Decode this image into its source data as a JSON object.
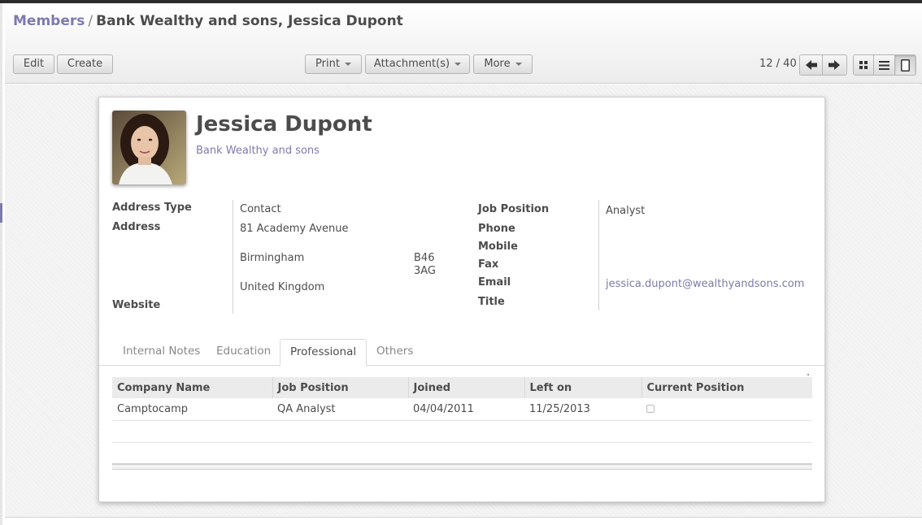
{
  "breadcrumb": {
    "parent": "Members",
    "separator": "/",
    "current": "Bank Wealthy and sons, Jessica Dupont"
  },
  "toolbar": {
    "edit": "Edit",
    "create": "Create",
    "print": "Print",
    "attachments": "Attachment(s)",
    "more": "More",
    "pager": "12 / 40"
  },
  "contact": {
    "name": "Jessica Dupont",
    "company": "Bank Wealthy and sons"
  },
  "left_fields": {
    "address_type_label": "Address Type",
    "address_type_value": "Contact",
    "address_label": "Address",
    "street": "81 Academy Avenue",
    "city": "Birmingham",
    "zip_line1": "B46",
    "zip_line2": "3AG",
    "country": "United Kingdom",
    "website_label": "Website"
  },
  "right_fields": {
    "job_position_label": "Job Position",
    "job_position_value": "Analyst",
    "phone_label": "Phone",
    "mobile_label": "Mobile",
    "fax_label": "Fax",
    "email_label": "Email",
    "email_value": "jessica.dupont@wealthyandsons.com",
    "title_label": "Title"
  },
  "tabs": [
    "Internal Notes",
    "Education",
    "Professional",
    "Others"
  ],
  "active_tab": "Professional",
  "table": {
    "headers": [
      "Company Name",
      "Job Position",
      "Joined",
      "Left on",
      "Current Position"
    ],
    "rows": [
      [
        "Camptocamp",
        "QA Analyst",
        "04/04/2011",
        "11/25/2013",
        false
      ]
    ]
  },
  "colors": {
    "accent": "#7c7bad",
    "text": "#4c4c4c"
  },
  "icons": [
    "arrow-left-icon",
    "arrow-right-icon",
    "kanban-view-icon",
    "list-view-icon",
    "form-view-icon"
  ]
}
